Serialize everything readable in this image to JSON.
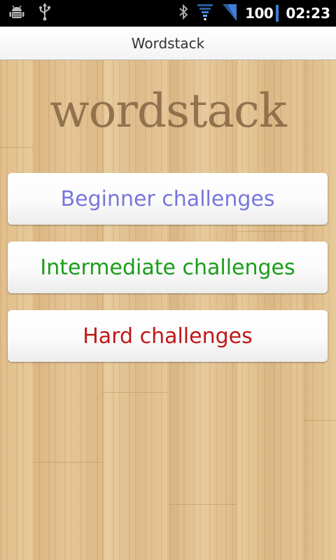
{
  "status_bar": {
    "left_icons": [
      "android-debug-icon",
      "usb-icon"
    ],
    "right_icons": [
      "bluetooth-icon",
      "wifi-icon",
      "signal-icon"
    ],
    "battery_level": "100",
    "time": "02:23"
  },
  "title_bar": {
    "title": "Wordstack"
  },
  "logo": {
    "text": "wordstack",
    "color": "#8a6a47"
  },
  "buttons": {
    "beginner": {
      "label": "Beginner challenges",
      "color": "#7777dd"
    },
    "intermediate": {
      "label": "Intermediate challenges",
      "color": "#1a9e1a"
    },
    "hard": {
      "label": "Hard challenges",
      "color": "#c01818"
    }
  }
}
